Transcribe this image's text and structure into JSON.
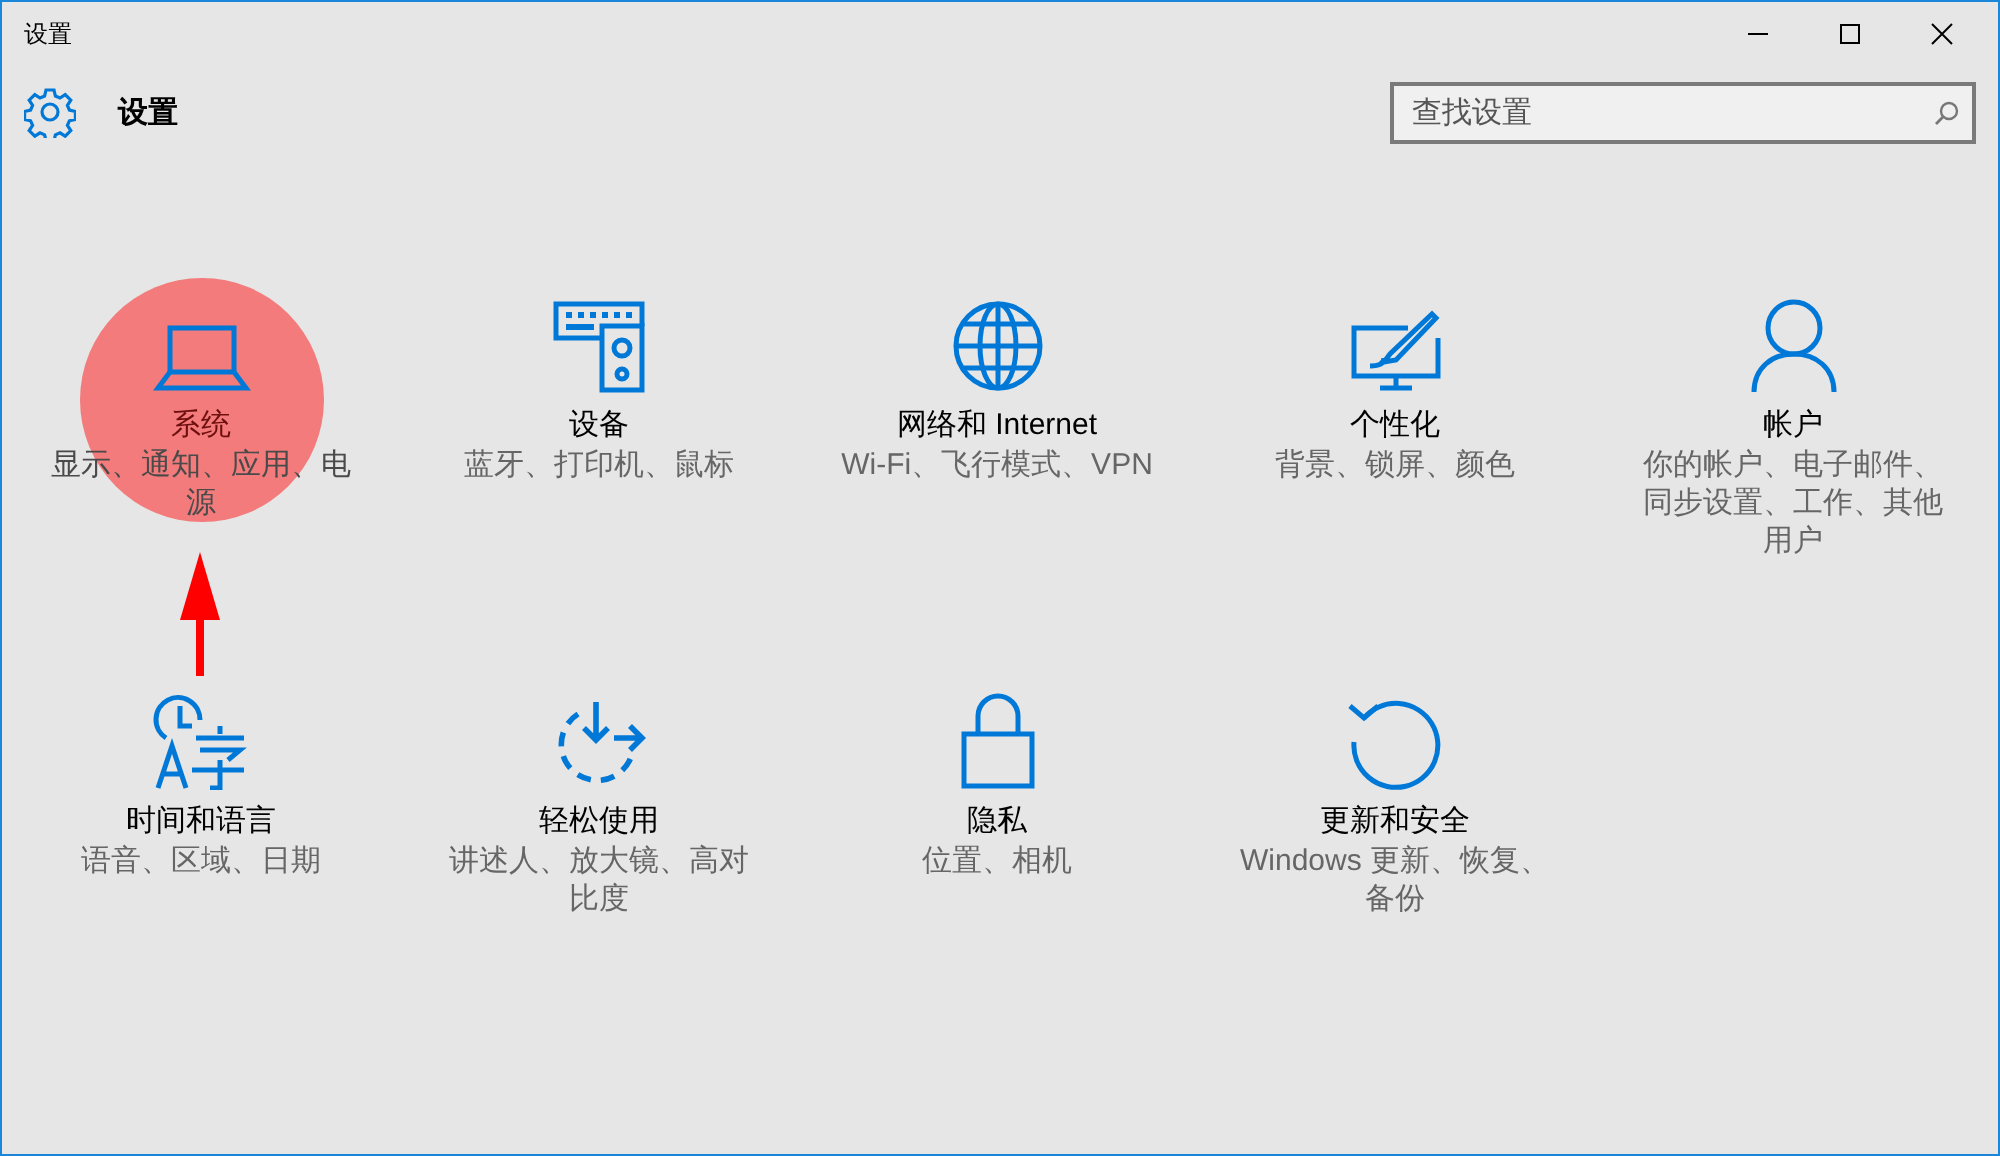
{
  "window": {
    "title": "设置"
  },
  "header": {
    "title": "设置"
  },
  "search": {
    "placeholder": "查找设置"
  },
  "categories": [
    {
      "title": "系统",
      "description": "显示、通知、应用、电源",
      "highlighted": true
    },
    {
      "title": "设备",
      "description": "蓝牙、打印机、鼠标",
      "highlighted": false
    },
    {
      "title": "网络和 Internet",
      "description": "Wi-Fi、飞行模式、VPN",
      "highlighted": false
    },
    {
      "title": "个性化",
      "description": "背景、锁屏、颜色",
      "highlighted": false
    },
    {
      "title": "帐户",
      "description": "你的帐户、电子邮件、同步设置、工作、其他用户",
      "highlighted": false
    },
    {
      "title": "时间和语言",
      "description": "语音、区域、日期",
      "highlighted": false
    },
    {
      "title": "轻松使用",
      "description": "讲述人、放大镜、高对比度",
      "highlighted": false
    },
    {
      "title": "隐私",
      "description": "位置、相机",
      "highlighted": false
    },
    {
      "title": "更新和安全",
      "description": "Windows 更新、恢复、备份",
      "highlighted": false
    }
  ]
}
